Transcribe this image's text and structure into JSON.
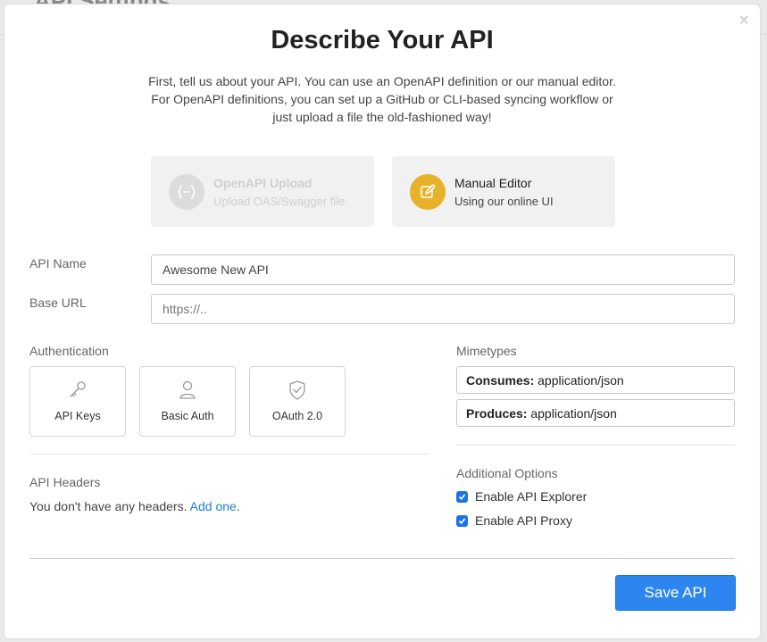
{
  "backdrop": {
    "title": "API Settings"
  },
  "modal": {
    "close_glyph": "×",
    "title": "Describe Your API",
    "intro": [
      "First, tell us about your API. You can use an OpenAPI definition or our manual editor.",
      "For OpenAPI definitions, you can set up a GitHub or CLI-based syncing workflow or",
      "just upload a file the old-fashioned way!"
    ]
  },
  "modes": [
    {
      "title": "OpenAPI Upload",
      "subtitle": "Upload OAS/Swagger file",
      "icon": "code-braces-icon",
      "state": "disabled"
    },
    {
      "title": "Manual Editor",
      "subtitle": "Using our online UI",
      "icon": "pencil-edit-icon",
      "state": "selected",
      "accent": "#e5b22a"
    }
  ],
  "form": {
    "api_name": {
      "label": "API Name",
      "value": "Awesome New API"
    },
    "base_url": {
      "label": "Base URL",
      "placeholder": "https://.."
    }
  },
  "authentication": {
    "label": "Authentication",
    "options": [
      {
        "label": "API Keys",
        "icon": "key-icon"
      },
      {
        "label": "Basic Auth",
        "icon": "user-icon"
      },
      {
        "label": "OAuth 2.0",
        "icon": "shield-check-icon"
      }
    ]
  },
  "mimetypes": {
    "label": "Mimetypes",
    "consumes": {
      "key": "Consumes:",
      "value": "application/json"
    },
    "produces": {
      "key": "Produces:",
      "value": "application/json"
    }
  },
  "headers": {
    "label": "API Headers",
    "empty_text": "You don't have any headers.",
    "add_link": "Add one",
    "period": "."
  },
  "additional_options": {
    "label": "Additional Options",
    "options": [
      {
        "label": "Enable API Explorer",
        "checked": true
      },
      {
        "label": "Enable API Proxy",
        "checked": true
      }
    ]
  },
  "footer": {
    "save_label": "Save API"
  },
  "colors": {
    "primary": "#2d86f0",
    "link": "#1a7fd6",
    "checkbox": "#1a73e8"
  }
}
